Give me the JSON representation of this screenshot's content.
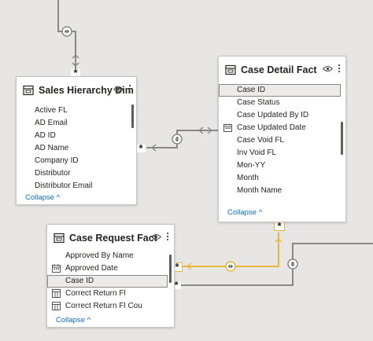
{
  "tables": {
    "sales_hierarchy_dim": {
      "title": "Sales Hierarchy Dim",
      "fields": [
        {
          "label": "Active FL",
          "icon": "none"
        },
        {
          "label": "AD Email",
          "icon": "none"
        },
        {
          "label": "AD ID",
          "icon": "none"
        },
        {
          "label": "AD Name",
          "icon": "none"
        },
        {
          "label": "Company ID",
          "icon": "none"
        },
        {
          "label": "Distributor",
          "icon": "none"
        },
        {
          "label": "Distributor Email",
          "icon": "none"
        }
      ],
      "collapse_label": "Collapse ^"
    },
    "case_detail_fact": {
      "title": "Case Detail Fact",
      "fields": [
        {
          "label": "Case ID",
          "icon": "none",
          "selected": true
        },
        {
          "label": "Case Status",
          "icon": "none"
        },
        {
          "label": "Case Updated By ID",
          "icon": "none"
        },
        {
          "label": "Case Updated Date",
          "icon": "calendar-icon"
        },
        {
          "label": "Case Void FL",
          "icon": "none"
        },
        {
          "label": "Inv Void FL",
          "icon": "none"
        },
        {
          "label": "Mon-YY",
          "icon": "none"
        },
        {
          "label": "Month",
          "icon": "none"
        },
        {
          "label": "Month Name",
          "icon": "none"
        }
      ],
      "collapse_label": "Collapse ^"
    },
    "case_request_fact": {
      "title": "Case Request Fact",
      "fields": [
        {
          "label": "Approved By Name",
          "icon": "none"
        },
        {
          "label": "Approved Date",
          "icon": "calendar-icon"
        },
        {
          "label": "Case ID",
          "icon": "none",
          "selected": true
        },
        {
          "label": "Correct Return Fl",
          "icon": "calculated-table-icon"
        },
        {
          "label": "Correct Return Fl Cou",
          "icon": "calculated-table-icon"
        }
      ],
      "collapse_label": "Collapse ^"
    }
  },
  "relationships": {
    "sales_to_detail": {
      "from_card": "*",
      "to_card": "*",
      "direction": "both"
    },
    "top_to_sales": {
      "to_card": "*",
      "direction": "both"
    },
    "request_to_detail": {
      "from_card": "*",
      "to_card": "*",
      "direction": "both",
      "highlighted": true
    },
    "request_to_right": {
      "from_card": "*",
      "direction": "both"
    }
  },
  "colors": {
    "canvas": "#e7e6e5",
    "line": "#8a8886",
    "highlight_line": "#e8b83a",
    "link_text": "#0f6cbd"
  }
}
